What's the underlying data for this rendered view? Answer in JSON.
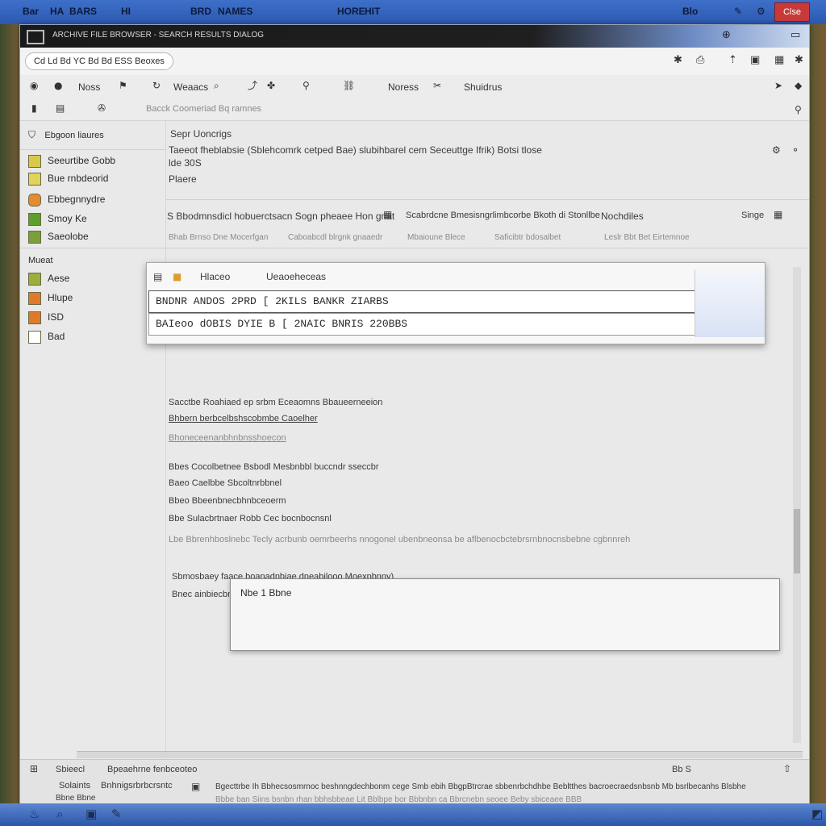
{
  "desktop": {
    "menu": [
      "Bar",
      "HA",
      "BARS",
      "HI",
      "BRD",
      "NAMES",
      "HORE",
      "HIT",
      "Blo"
    ],
    "close_label": "Clse"
  },
  "window": {
    "title": "ARCHIVE FILE BROWSER - SEARCH RESULTS DIALOG",
    "address": {
      "path": "Cd  Ld  Bd  YC Bd  Bd  ESS  Beoxes"
    },
    "toolbar": {
      "row1": [
        "Noss",
        "Weaacs",
        "Noress",
        "Shuidrus"
      ],
      "row2_label": "Bacck Coomeriad Bq ramnes"
    },
    "sidebar": {
      "header": "Ebgoon liaures",
      "items": [
        "Seeurtibe Gobb",
        "Bue rnbdeorid",
        "Ebbegnnydre",
        "Smoy Ke",
        "Saeolobe"
      ],
      "section2_title": "Mueat",
      "section2_items": [
        "Aese",
        "Hlupe",
        "ISD",
        "Bad"
      ]
    },
    "content": {
      "heading": "Sepr Uoncrigs",
      "desc1": "Taeeot fheblabsie (Sblehcomrk cetped Bae) slubihbarel cem Seceuttge Ifrik) Botsi tlose",
      "desc2": "lde 30S",
      "desc3": "Plaere",
      "filter_left": "S  Bbodmnsdicl hobuerctsacn Sogn pheaee Hon gnat",
      "filter_mid": "Scabrdcne Bmesisngrlimbcorbe Bkoth di Stonllbe",
      "filter_right": "Nochdiles",
      "filter_far": "Singe",
      "sub_filter": [
        "Bhab Brnso Dne Mocerfgan",
        "Caboabcdl blrgnk gnaaedr",
        "Mbaioune  Blece",
        "Saficibtr bdosalbet",
        "Leslr Bbt Bet Eirtemnoe"
      ],
      "list_title": "Sacctbe Roahiaed ep srbm Eceaomns Bbaueerneeion",
      "list_sub": "Bhbern berbcelbshscobmbe Caoelher",
      "list_sub2": "Bhoneceenanbhnbnsshoecon",
      "detail_rows": [
        "Bbes  Cocolbetnee Bsbodl Mesbnbbl buccndr sseccbr",
        "Baeo  Caelbbe  Sbcoltnrbbnel",
        "Bbeo  Bbeenbnecbhnbceoerm",
        "Bbe  Sulacbrtnaer Robb Cec bocnbocnsnl"
      ],
      "long_row": "Lbe Bbrenhboslnebc Tecly acrbunb oemrbeerhs nnogonel ubenbneonsa be aflbenocbctebrsrnbnocnsbebne cgbnnreh",
      "section_title": "Sbmosbaey faace boanadnbiae dneabilooo Moexpbnny)",
      "section_sub": "Bnec ainbiecbn adrbaooonegdntctm ecrbnee"
    },
    "search_dropdown": {
      "header_left": "Hlaceo",
      "header_right": "Ueaoeheceas",
      "rows": [
        "BNDNR ANDOS 2PRD  [  2KILS  BANKR  ZIARBS",
        "BAIeoo dOBIS DYIE  B  [  2NAIC  BNRIS  220BBS"
      ]
    },
    "note": {
      "text": "Nbe 1 Bbne"
    },
    "status": {
      "left1": "Sbieecl",
      "left2": "Solaints",
      "left3": "Bbne Bbne",
      "mid1": "Bpeaehrne fenbceoteo",
      "mid2": "Bnhnigsrbrbcrsntc",
      "long1": "Bgecttrbe Ih Bbhecsosmrnoc beshnngdechbonm cege Smb ebih BbgpBtrcrae sbbenrbchdhbe Bebltthes bacroecraedsnbsnb Mb bsrlbecanhs Blsbhe",
      "long2": "Bbbe ban Siins bsnbn rhan bbhsbbeae Lit Bblbpe bor Bbbnbn ca Bbrcnebn seoee Beby sbiceaee BBB",
      "page": "Bb S"
    }
  },
  "colors": {
    "accent": "#2c58b0",
    "close": "#c83a3a",
    "titlebar": "#1a1a1a"
  }
}
